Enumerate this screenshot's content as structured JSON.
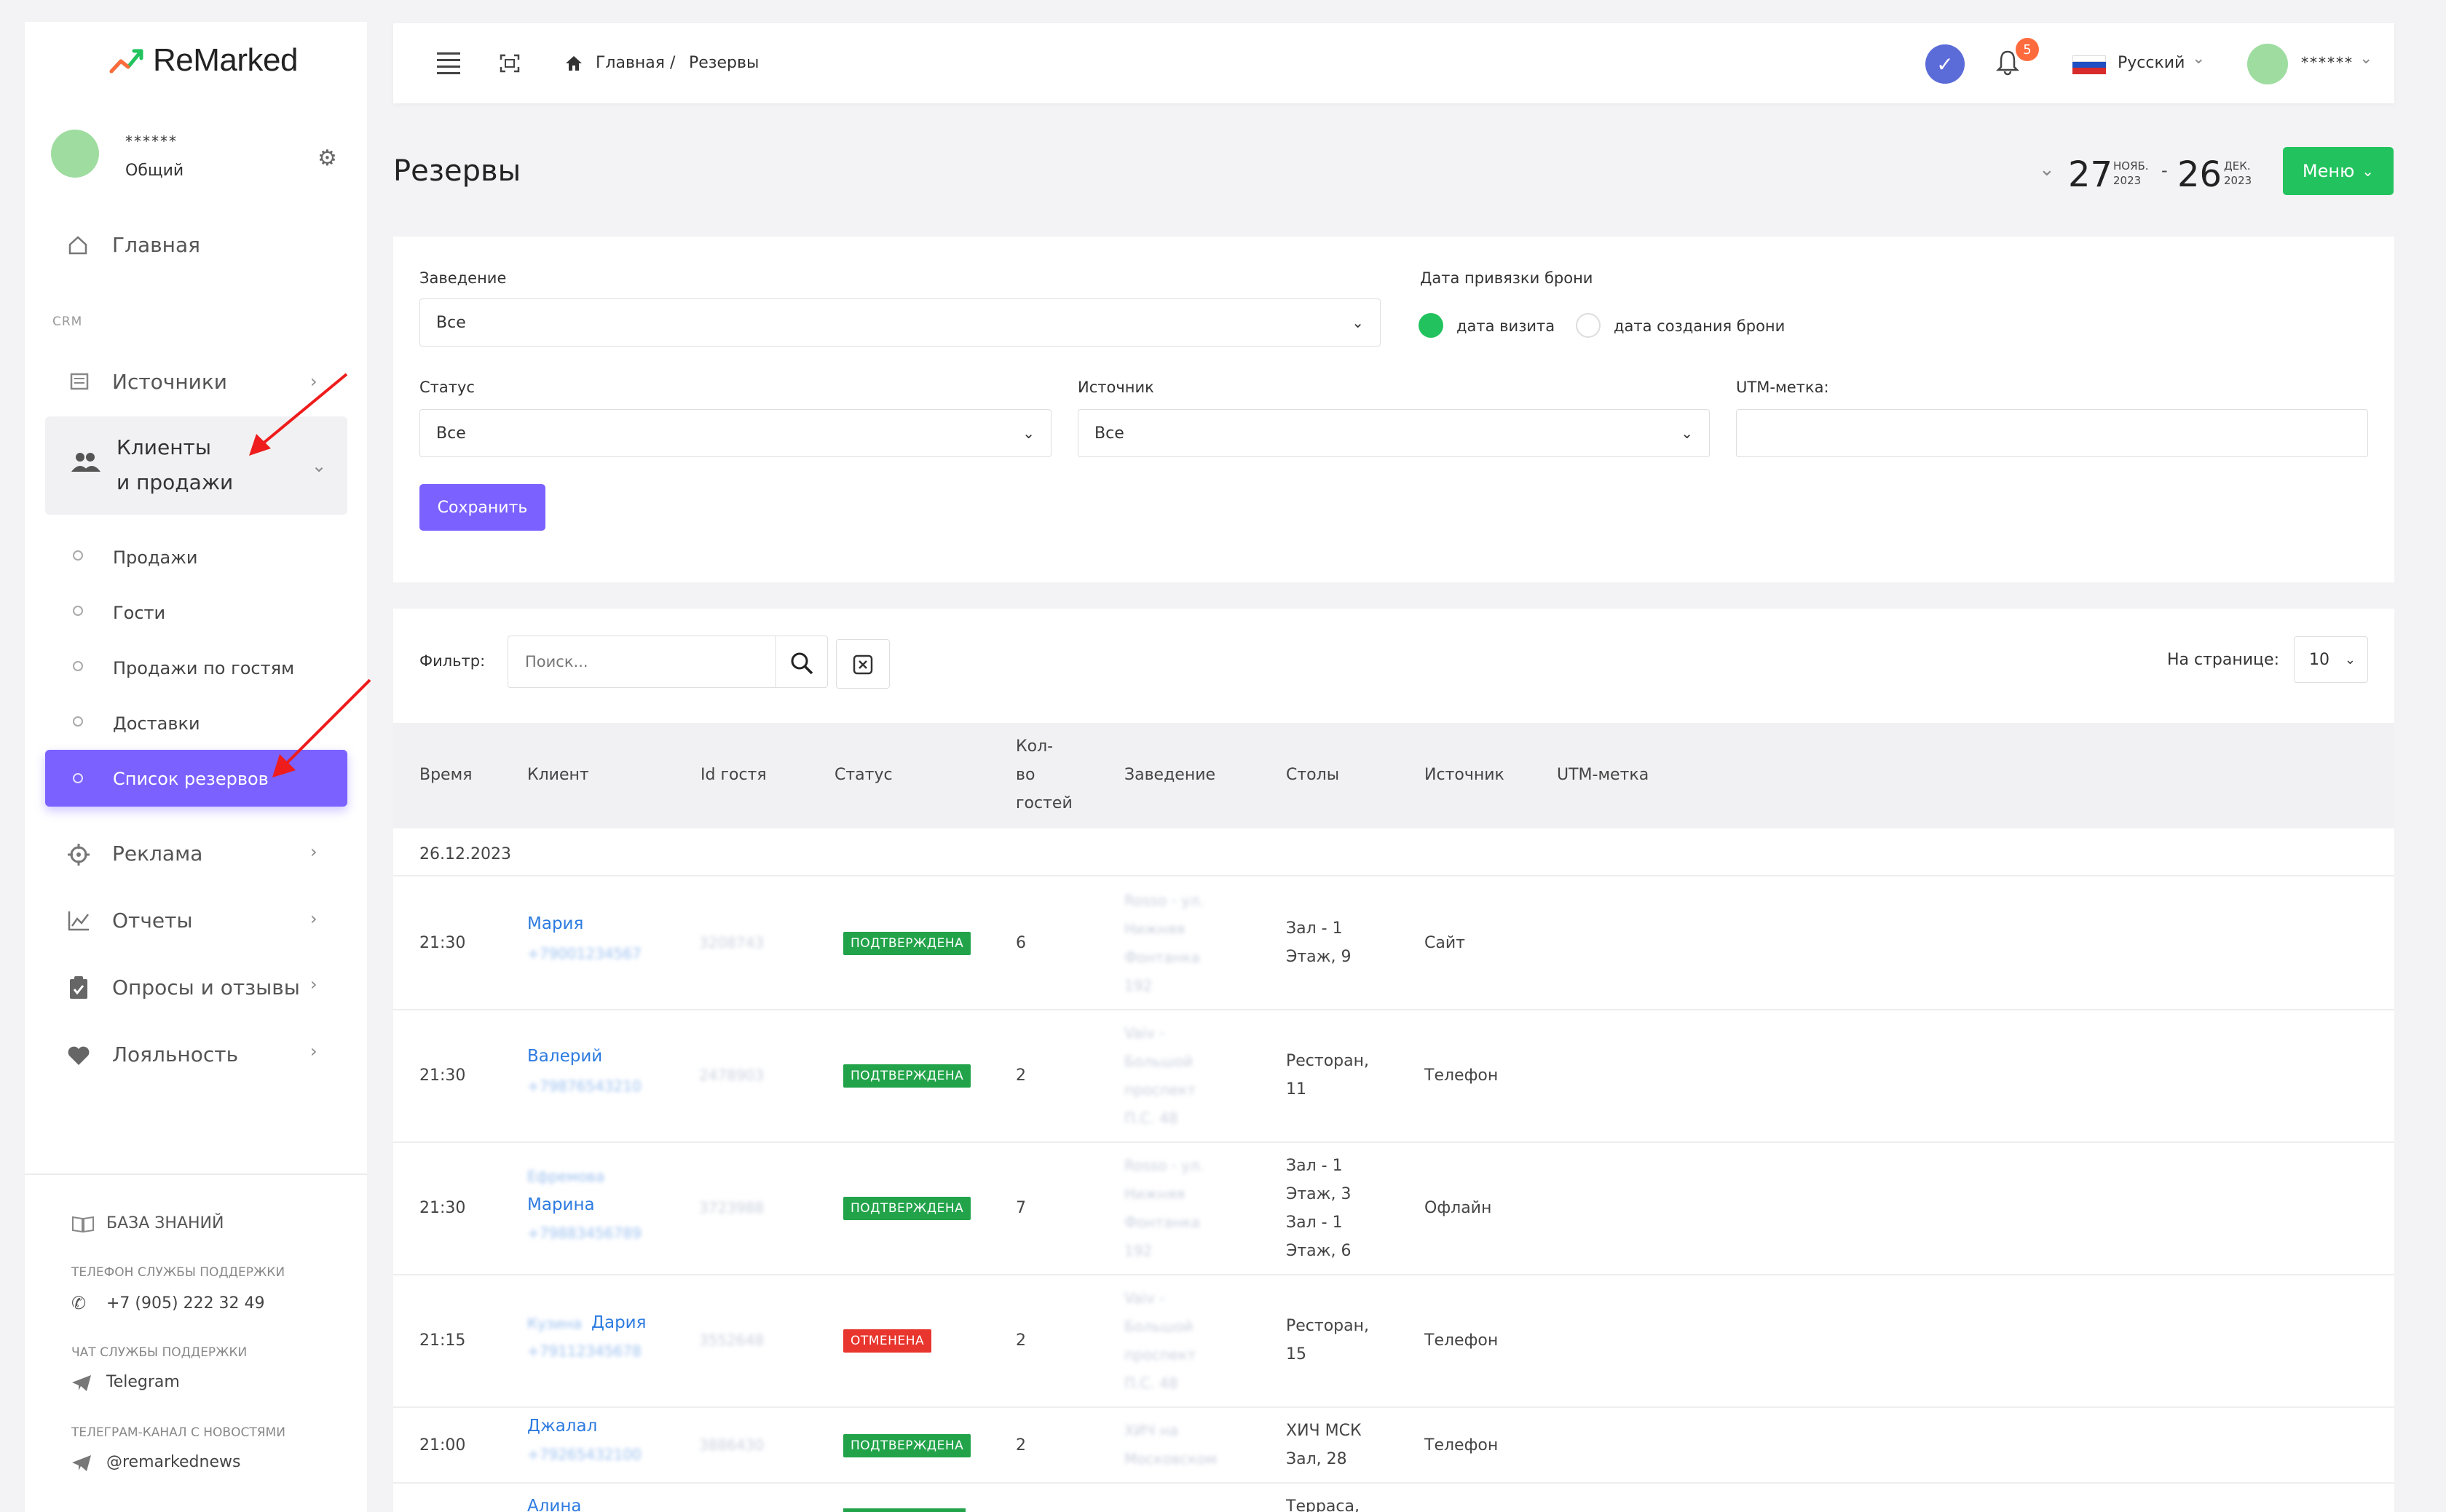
{
  "app": {
    "logo_text": "ReMarked",
    "user_name": "******",
    "user_role": "Общий"
  },
  "sidebar": {
    "home": "Главная",
    "section_crm": "CRM",
    "sources": "Источники",
    "clients_line1": "Клиенты",
    "clients_line2": "и продажи",
    "sub_items": [
      "Продажи",
      "Гости",
      "Продажи по гостям",
      "Доставки"
    ],
    "active_item": "Список резервов",
    "ads": "Реклама",
    "reports": "Отчеты",
    "surveys": "Опросы и отзывы",
    "loyalty": "Лояльность",
    "knowledge_base": "БАЗА ЗНАНИЙ",
    "support_phone_label": "ТЕЛЕФОН СЛУЖБЫ ПОДДЕРЖКИ",
    "support_phone": "+7 (905) 222 32 49",
    "support_chat_label": "ЧАТ СЛУЖБЫ ПОДДЕРЖКИ",
    "support_chat": "Telegram",
    "news_label": "ТЕЛЕГРАМ-КАНАЛ С НОВОСТЯМИ",
    "news_channel": "@remarkednews"
  },
  "topbar": {
    "breadcrumb_home": "Главная",
    "breadcrumb_sep": "/",
    "breadcrumb_current": "Резервы",
    "notifications_count": "5",
    "language": "Русский",
    "account_name": "******"
  },
  "header": {
    "title": "Резервы",
    "date_from_day": "27",
    "date_from_month": "НОЯБ.",
    "date_from_year": "2023",
    "date_sep": "-",
    "date_to_day": "26",
    "date_to_month": "ДЕК.",
    "date_to_year": "2023",
    "menu_label": "Меню"
  },
  "filters": {
    "venue_label": "Заведение",
    "venue_value": "Все",
    "binding_label": "Дата привязки брони",
    "radio_visit": "дата визита",
    "radio_created": "дата создания брони",
    "status_label": "Статус",
    "status_value": "Все",
    "source_label": "Источник",
    "source_value": "Все",
    "utm_label": "UTM-метка:",
    "utm_value": "",
    "save_label": "Сохранить"
  },
  "table": {
    "filter_label": "Фильтр:",
    "search_placeholder": "Поиск...",
    "per_page_label": "На странице:",
    "per_page_value": "10",
    "columns": {
      "time": "Время",
      "client": "Клиент",
      "guest_id": "Id гостя",
      "status": "Статус",
      "guests_l1": "Кол-",
      "guests_l2": "во",
      "guests_l3": "гостей",
      "venue": "Заведение",
      "tables": "Столы",
      "source": "Источник",
      "utm": "UTM-метка"
    },
    "group_date": "26.12.2023",
    "rows": [
      {
        "time": "21:30",
        "client": "Мария",
        "phone": "+79001234567",
        "guest_id": "3208743",
        "status": "ПОДТВЕРЖДЕНА",
        "guests": "6",
        "venue_l1": "Rosso - ул.",
        "venue_l2": "Нижняя",
        "venue_l3": "Фонтанка",
        "venue_l4": "192",
        "tables_l1": "Зал - 1",
        "tables_l2": "Этаж, 9",
        "source": "Сайт"
      },
      {
        "time": "21:30",
        "client": "Валерий",
        "phone": "+79876543210",
        "guest_id": "2478903",
        "status": "ПОДТВЕРЖДЕНА",
        "guests": "2",
        "venue_l1": "Vaiv -",
        "venue_l2": "Большой",
        "venue_l3": "проспект",
        "venue_l4": "П.С. 48",
        "tables_l1": "Ресторан,",
        "tables_l2": "11",
        "source": "Телефон"
      },
      {
        "time": "21:30",
        "client": "Марина",
        "client_prefix": "Ефремова",
        "phone": "+79883456789",
        "guest_id": "3723988",
        "status": "ПОДТВЕРЖДЕНА",
        "guests": "7",
        "venue_l1": "Rosso - ул.",
        "venue_l2": "Нижняя",
        "venue_l3": "Фонтанка",
        "venue_l4": "192",
        "tables_l1": "Зал - 1",
        "tables_l2": "Этаж, 3",
        "tables_l3": "Зал - 1",
        "tables_l4": "Этаж, 6",
        "source": "Офлайн"
      },
      {
        "time": "21:15",
        "client": "Дария",
        "client_prefix": "Кузина",
        "phone": "+79112345678",
        "guest_id": "3552648",
        "status": "ОТМЕНЕНА",
        "guests": "2",
        "venue_l1": "Vaiv -",
        "venue_l2": "Большой",
        "venue_l3": "проспект",
        "venue_l4": "П.С. 48",
        "tables_l1": "Ресторан,",
        "tables_l2": "15",
        "source": "Телефон"
      },
      {
        "time": "21:00",
        "client": "Джалал",
        "phone": "+79265432100",
        "guest_id": "3886430",
        "status": "ПОДТВЕРЖДЕНА",
        "guests": "2",
        "venue_l1": "ХИЧ на",
        "venue_l2": "Московском",
        "tables_l1": "ХИЧ МСК",
        "tables_l2": "Зал, 28",
        "source": "Телефон"
      },
      {
        "time": "",
        "client": "Алина",
        "tables_l1": "Терраса,"
      }
    ]
  },
  "colors": {
    "accent": "#7b61ff",
    "success": "#22c35e",
    "confirmed": "#22a34a",
    "cancelled": "#e8352d",
    "link": "#2d7be0"
  }
}
